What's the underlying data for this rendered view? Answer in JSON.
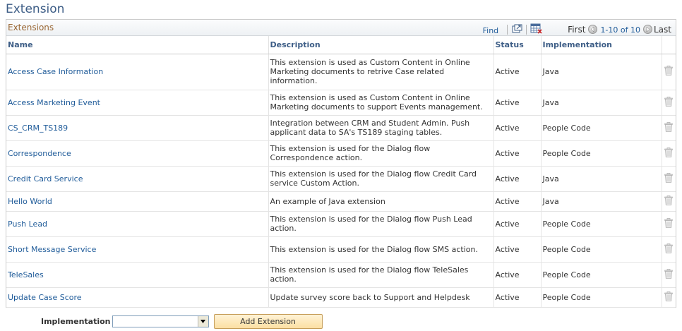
{
  "page": {
    "title": "Extension"
  },
  "grid": {
    "title": "Extensions",
    "find_label": "Find",
    "nav": {
      "first": "First",
      "range": "1-10 of 10",
      "last": "Last"
    },
    "columns": {
      "name": "Name",
      "description": "Description",
      "status": "Status",
      "implementation": "Implementation"
    },
    "rows": [
      {
        "name": "Access Case Information",
        "description": "This extension is used as Custom Content in Online Marketing documents to retrive Case related information.",
        "status": "Active",
        "implementation": "Java"
      },
      {
        "name": "Access Marketing Event",
        "description": "This extension is used as Custom Content in Online Marketing documents to support Events management.",
        "status": "Active",
        "implementation": "Java"
      },
      {
        "name": "CS_CRM_TS189",
        "description": "Integration between CRM and Student Admin.  Push applicant data to SA's TS189 staging tables.",
        "status": "Active",
        "implementation": "People Code"
      },
      {
        "name": "Correspondence",
        "description": "This extension is used for the Dialog flow Correspondence action.",
        "status": "Active",
        "implementation": "People Code"
      },
      {
        "name": "Credit Card Service",
        "description": "This extension is used for the Dialog flow Credit Card service Custom Action.",
        "status": "Active",
        "implementation": "Java"
      },
      {
        "name": "Hello World",
        "description": "An example of Java extension",
        "status": "Active",
        "implementation": "Java"
      },
      {
        "name": "Push Lead",
        "description": "This extension is used for the Dialog flow Push Lead action.",
        "status": "Active",
        "implementation": "People Code"
      },
      {
        "name": "Short Message Service",
        "description": "This extension is used for the Dialog flow SMS action.",
        "status": "Active",
        "implementation": "People Code"
      },
      {
        "name": "TeleSales",
        "description": "This extension is used for the Dialog flow TeleSales action.",
        "status": "Active",
        "implementation": "People Code"
      },
      {
        "name": "Update Case Score",
        "description": "Update survey score back to Support and Helpdesk",
        "status": "Active",
        "implementation": "People Code"
      }
    ]
  },
  "add_area": {
    "implementation_label": "Implementation",
    "implementation_value": "",
    "add_button_label": "Add Extension"
  },
  "icons": {
    "view_all": "new-window-icon",
    "download": "spreadsheet-icon",
    "prev": "prev-arrow-icon",
    "next": "next-arrow-icon",
    "delete": "trash-icon"
  },
  "colors": {
    "link": "#1f5b99",
    "title": "#3d5d86",
    "grid_title": "#996633",
    "button": "#fbdfa2"
  }
}
